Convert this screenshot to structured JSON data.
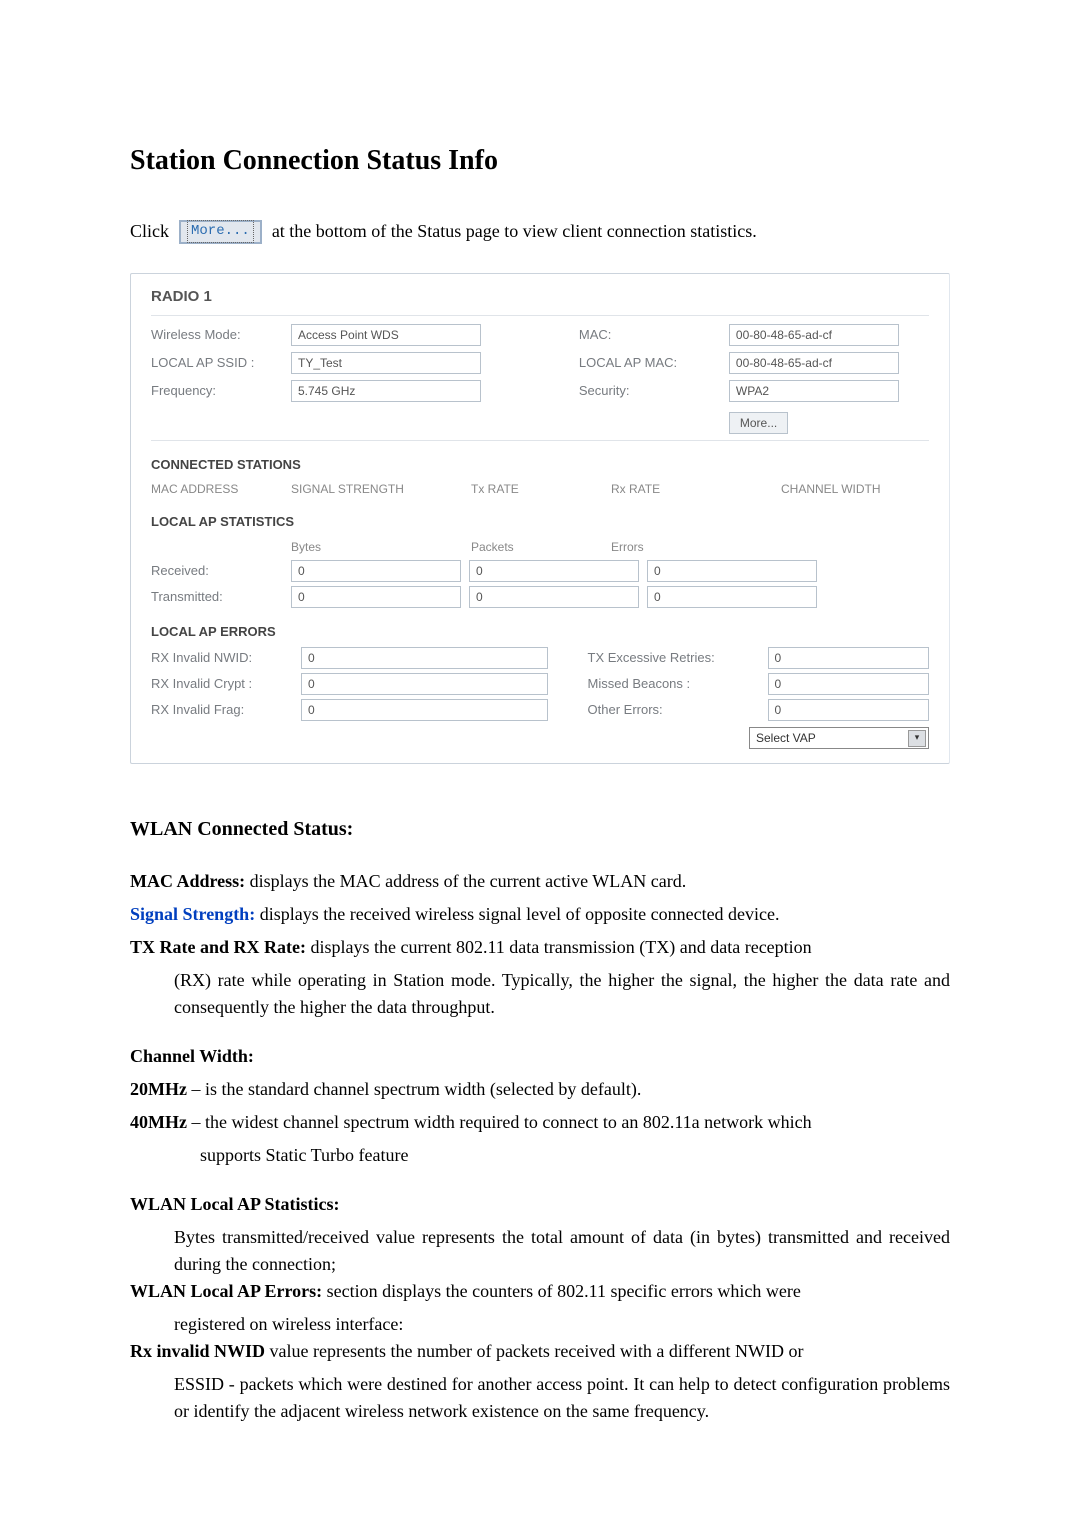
{
  "title": "Station Connection Status Info",
  "clickLine": {
    "before": "Click",
    "button": "More...",
    "after": "at the bottom of the Status page to view client connection statistics."
  },
  "panel": {
    "header": "RADIO 1",
    "wirelessMode": {
      "label": "Wireless Mode:",
      "value": "Access Point WDS"
    },
    "localSsid": {
      "label": "LOCAL AP SSID :",
      "value": "TY_Test"
    },
    "frequency": {
      "label": "Frequency:",
      "value": "5.745 GHz"
    },
    "mac": {
      "label": "MAC:",
      "value": "00-80-48-65-ad-cf"
    },
    "localApMac": {
      "label": "LOCAL AP MAC:",
      "value": "00-80-48-65-ad-cf"
    },
    "security": {
      "label": "Security:",
      "value": "WPA2"
    },
    "moreBtn": "More...",
    "connectedStations": {
      "title": "CONNECTED STATIONS",
      "h_mac": "MAC ADDRESS",
      "h_sig": "SIGNAL STRENGTH",
      "h_tx": "Tx RATE",
      "h_rx": "Rx RATE",
      "h_cw": "CHANNEL WIDTH"
    },
    "localStats": {
      "title": "LOCAL AP STATISTICS",
      "h_bytes": "Bytes",
      "h_packets": "Packets",
      "h_errors": "Errors",
      "received": {
        "label": "Received:",
        "bytes": "0",
        "packets": "0",
        "errors": "0"
      },
      "transmitted": {
        "label": "Transmitted:",
        "bytes": "0",
        "packets": "0",
        "errors": "0"
      }
    },
    "localErrors": {
      "title": "LOCAL AP ERRORS",
      "nwid": {
        "label": "RX Invalid NWID:",
        "value": "0"
      },
      "crypt": {
        "label": "RX Invalid Crypt :",
        "value": "0"
      },
      "frag": {
        "label": "RX Invalid Frag:",
        "value": "0"
      },
      "retries": {
        "label": "TX Excessive Retries:",
        "value": "0"
      },
      "beacons": {
        "label": "Missed Beacons :",
        "value": "0"
      },
      "other": {
        "label": "Other Errors:",
        "value": "0"
      }
    },
    "selectVap": "Select VAP"
  },
  "wlan": {
    "heading": "WLAN Connected Status:",
    "macAddr": {
      "term": "MAC Address:",
      "text": " displays the MAC address of the current active WLAN card."
    },
    "sigStr": {
      "term": "Signal Strength:",
      "text": " displays the received wireless signal level of opposite connected device."
    },
    "txrx": {
      "term": "TX Rate and RX Rate:",
      "text1": " displays the current 802.11 data transmission (TX) and data reception",
      "text2": "(RX) rate while operating in Station mode. Typically, the higher the signal, the higher the data rate and consequently the higher the data throughput."
    },
    "chwidth": {
      "title": "Channel Width:",
      "l20": {
        "term": "20MHz",
        "text": " – is the standard channel spectrum width (selected by default)."
      },
      "l40": {
        "term": "40MHz",
        "text1": " – the widest channel spectrum width required to connect to an 802.11a network which",
        "text2": "supports Static Turbo feature"
      }
    },
    "localStats": {
      "title": "WLAN Local AP Statistics:",
      "text": "Bytes transmitted/received value represents the total amount of data (in bytes) transmitted and received during the connection;"
    },
    "localErr": {
      "term": "WLAN Local AP Errors:",
      "text1": " section displays the counters of 802.11 specific errors which were",
      "text2": "registered on wireless interface:"
    },
    "rxNwid": {
      "term": "Rx invalid NWID",
      "text1": " value represents the number of packets received with a different NWID or",
      "text2": "ESSID - packets which were destined for another access point. It can help to detect configuration problems or identify the adjacent wireless network existence on the same frequency."
    }
  }
}
